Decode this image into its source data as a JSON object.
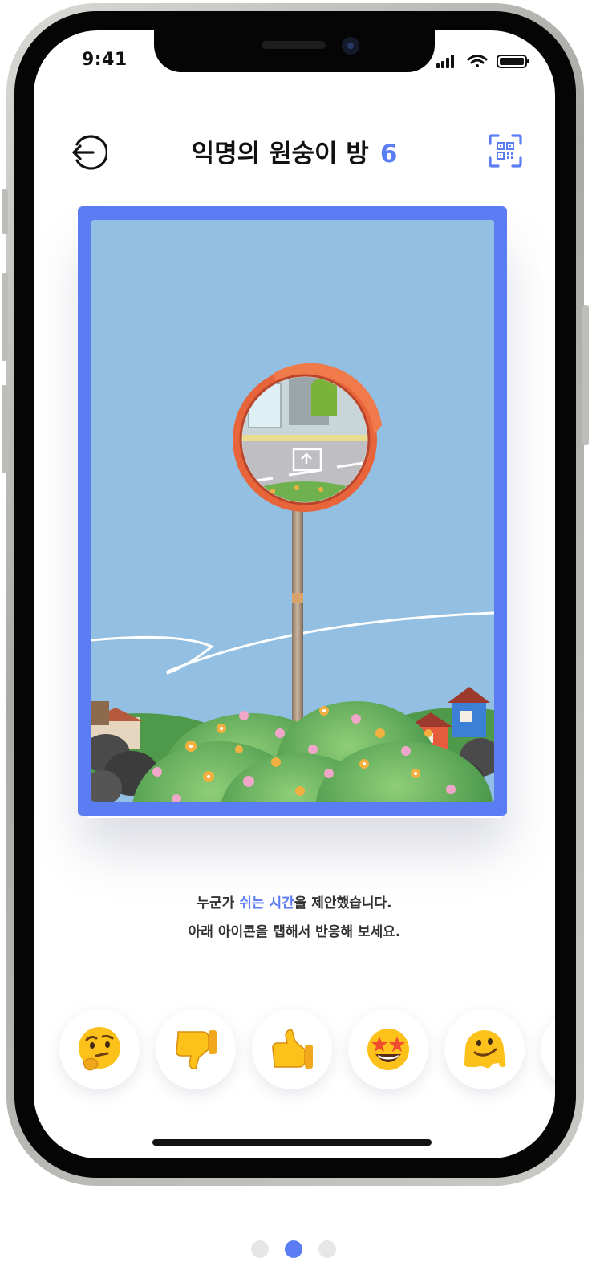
{
  "status_bar": {
    "time": "9:41"
  },
  "header": {
    "title": "익명의 원숭이 방",
    "count": "6",
    "back_icon": "back-arrow-circle-icon",
    "scan_icon": "qr-scan-icon"
  },
  "message": {
    "line1_prefix": "누군가 ",
    "line1_highlight": "쉬는 시간",
    "line1_suffix": "을 제안했습니다.",
    "line2": "아래 아이콘을 탭해서 반응해 보세요."
  },
  "reactions": [
    {
      "name": "thinking-face-emoji",
      "icon": "thinking-face"
    },
    {
      "name": "thumbs-down-emoji",
      "icon": "thumbs-down"
    },
    {
      "name": "thumbs-up-emoji",
      "icon": "thumbs-up"
    },
    {
      "name": "star-struck-emoji",
      "icon": "star-struck-face"
    },
    {
      "name": "melting-face-emoji",
      "icon": "melting-face"
    }
  ],
  "pagination": {
    "current": 2,
    "total": 3
  },
  "colors": {
    "accent": "#5a7df4",
    "sky": "#93bfe2",
    "mirror_rim": "#e8643a"
  }
}
